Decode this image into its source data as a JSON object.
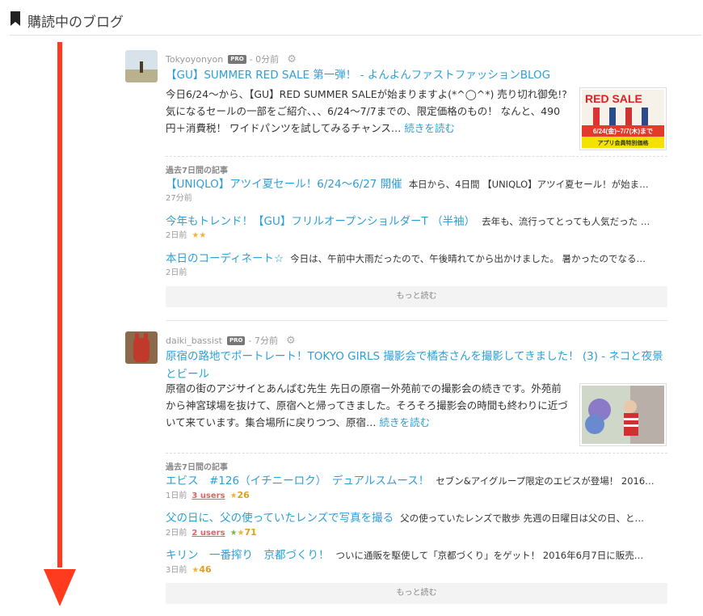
{
  "section": {
    "title": "購読中のブログ",
    "icon": "bookmark-icon"
  },
  "colors": {
    "link": "#2e9fd6",
    "arrow": "#ff3b1f"
  },
  "entries": [
    {
      "user": "Tokyoyonyon",
      "pro": "PRO",
      "time": "- 0分前",
      "title": "【GU】SUMMER RED SALE 第一弾！ - よんよんファストファッションBLOG",
      "excerpt": "今日6/24〜から、【GU】RED SUMMER SALEが始まりますよ(*^◯^*) 売り切れ御免!? 気になるセールの一部をご紹介、、、6/24〜7/7までの、限定価格のもの！ なんと、490円＋消費税！ ワイドパンツを試してみるチャンス…",
      "more": "続きを読む",
      "thumb": {
        "l1": "RED SALE",
        "l2": "6/24(金)~7/7(木)まで",
        "l3": "アプリ会員特別価格"
      },
      "past_label": "過去7日間の記事",
      "past": [
        {
          "title": "【UNIQLO】アツイ夏セール！6/24〜6/27 開催",
          "desc": "本日から、4日間 【UNIQLO】アツイ夏セール！が始ま…",
          "time": "27分前"
        },
        {
          "title": "今年もトレンド！【GU】フリルオープンショルダーT （半袖）",
          "desc": "去年も、流行ってとっても人気だった …",
          "time": "2日前",
          "stars": "★★"
        },
        {
          "title": "本日のコーディネート☆",
          "desc": "今日は、午前中大雨だったので、午後晴れてから出かけました。 暑かったのでなる…",
          "time": "2日前"
        }
      ],
      "more_button": "もっと読む"
    },
    {
      "user": "daiki_bassist",
      "pro": "PRO",
      "time": "- 7分前",
      "title": "原宿の路地でポートレート！TOKYO GIRLS 撮影会で橘杏さんを撮影してきました！ (3) - ネコと夜景とビール",
      "excerpt": "原宿の街のアジサイとあんぱむ先生 先日の原宿ー外苑前での撮影会の続きです。外苑前から神宮球場を抜けて、原宿へと帰ってきました。そろそろ撮影会の時間も終わりに近づいて来ています。集合場所に戻りつつ、原宿…",
      "more": "続きを読む",
      "past_label": "過去7日間の記事",
      "past": [
        {
          "title": "エビス　#126（イチニーロク）　デュアルスムース！",
          "desc": "セブン&アイグループ限定のエビスが登場！ 2016…",
          "time": "1日前",
          "users": "3 users",
          "stars": "★",
          "star_count": "26"
        },
        {
          "title": "父の日に、父の使っていたレンズで写真を撮る",
          "desc": "父の使っていたレンズで散歩 先週の日曜日は父の日、と…",
          "time": "2日前",
          "users": "2 users",
          "stars_green": "★",
          "stars": "★",
          "star_count": "71"
        },
        {
          "title": "キリン　一番搾り　京都づくり！",
          "desc": "ついに通販を駆使して「京都づくり」をゲット！ 2016年6月7日に販売…",
          "time": "3日前",
          "stars": "★",
          "star_count": "46"
        }
      ],
      "more_button": "もっと読む"
    }
  ]
}
